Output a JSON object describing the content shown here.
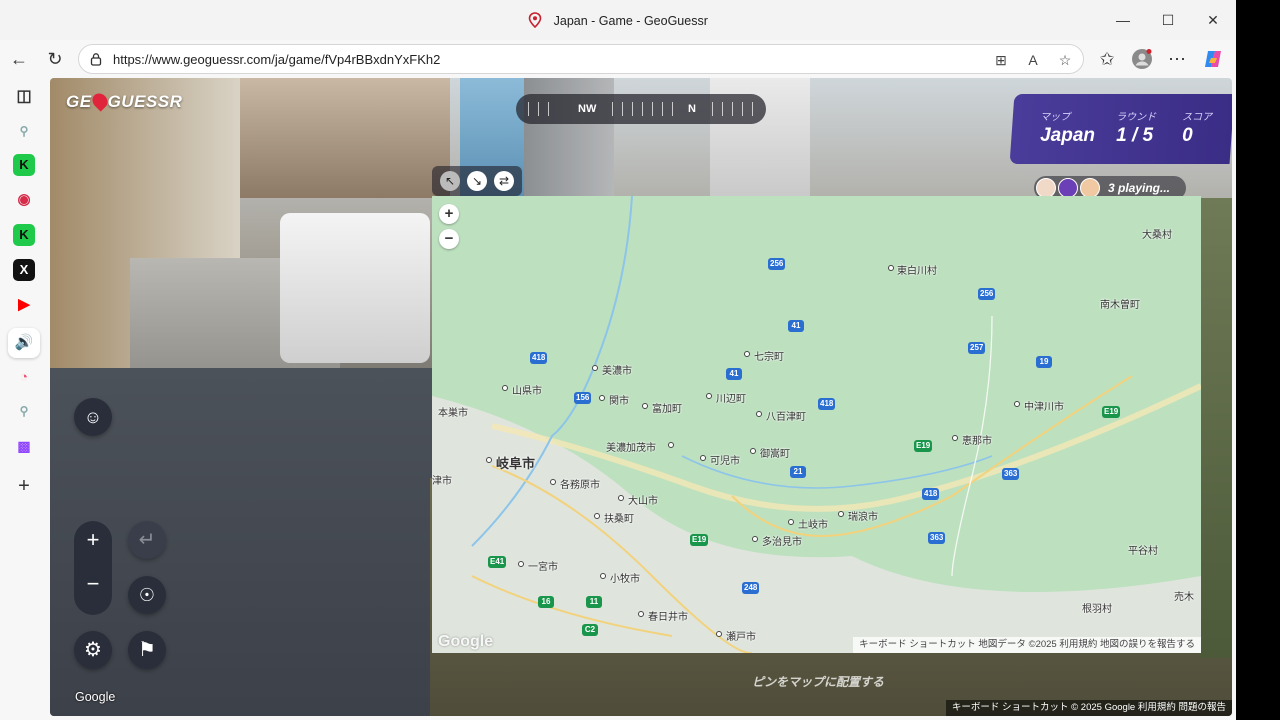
{
  "browser": {
    "tab_title": "Japan - Game - GeoGuessr",
    "url": "https://www.geoguessr.com/ja/game/fVp4rBBxdnYxFKh2"
  },
  "game": {
    "logo_prefix": "GE",
    "logo_suffix": "GUESSR",
    "compass_labels": [
      "NW",
      "N"
    ],
    "map_label": "マップ",
    "map_value": "Japan",
    "round_label": "ラウンド",
    "round_value": "1 / 5",
    "score_label": "スコア",
    "score_value": "0",
    "players_playing": "3 playing...",
    "place_pin_hint": "ピンをマップに配置する",
    "streetview_google": "Google",
    "streetview_footer": "キーボード ショートカット  © 2025 Google  利用規約  問題の報告"
  },
  "map": {
    "google_logo": "Google",
    "footer": "キーボード ショートカット   地図データ ©2025   利用規約   地図の誤りを報告する",
    "cities": [
      {
        "name": "大桑村"
      },
      {
        "name": "東白川村"
      },
      {
        "name": "南木曽町"
      },
      {
        "name": "七宗町"
      },
      {
        "name": "美濃市"
      },
      {
        "name": "山県市"
      },
      {
        "name": "本巣市"
      },
      {
        "name": "関市"
      },
      {
        "name": "富加町"
      },
      {
        "name": "川辺町"
      },
      {
        "name": "八百津町"
      },
      {
        "name": "中津川市"
      },
      {
        "name": "美濃加茂市"
      },
      {
        "name": "御嵩町"
      },
      {
        "name": "恵那市"
      },
      {
        "name": "岐阜市"
      },
      {
        "name": "可児市"
      },
      {
        "name": "各務原市"
      },
      {
        "name": "瑞浪市"
      },
      {
        "name": "大山市"
      },
      {
        "name": "土岐市"
      },
      {
        "name": "扶桑町"
      },
      {
        "name": "多治見市"
      },
      {
        "name": "一宮市"
      },
      {
        "name": "小牧市"
      },
      {
        "name": "平谷村"
      },
      {
        "name": "春日井市"
      },
      {
        "name": "根羽村"
      },
      {
        "name": "瀬戸市"
      },
      {
        "name": "売木"
      },
      {
        "name": "津市"
      }
    ],
    "routes": [
      "256",
      "418",
      "41",
      "256",
      "257",
      "19",
      "156",
      "41",
      "418",
      "E19",
      "E19",
      "21",
      "418",
      "363",
      "363",
      "E19",
      "E41",
      "16",
      "11",
      "248",
      "C2"
    ]
  }
}
